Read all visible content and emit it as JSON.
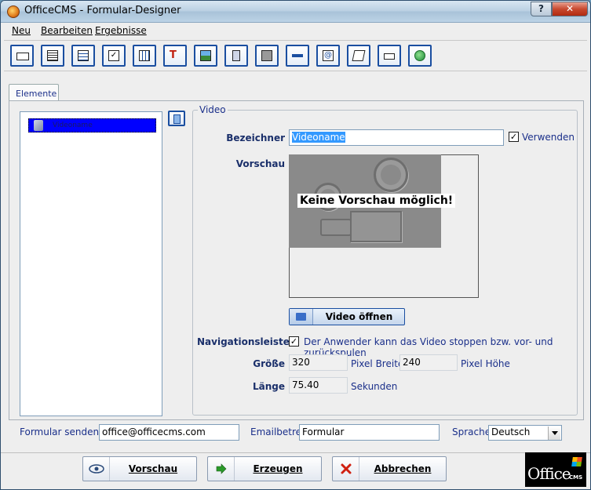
{
  "window": {
    "title": "OfficeCMS - Formular-Designer",
    "help_label": "?",
    "close_label": "✕"
  },
  "menu": {
    "items": [
      {
        "label": "Neu"
      },
      {
        "label": "Bearbeiten"
      },
      {
        "label": "Ergebnisse"
      }
    ]
  },
  "toolbar": {
    "buttons": [
      "textfield-icon",
      "textarea-icon",
      "list-icon",
      "checkbox-icon",
      "table-icon",
      "text-format-icon",
      "image-icon",
      "file-icon",
      "frame-icon",
      "separator-icon",
      "email-icon",
      "form-icon",
      "box-icon",
      "globe-icon"
    ]
  },
  "tabs": {
    "elements_label": "Elemente"
  },
  "element_list": {
    "selected_item": "Videoname"
  },
  "video_group": {
    "title": "Video",
    "bezeichner_label": "Bezeichner",
    "bezeichner_value": "Videoname",
    "verwenden_label": "Verwenden",
    "verwenden_checked": true,
    "vorschau_label": "Vorschau",
    "preview_message": "Keine Vorschau möglich!",
    "open_button_label": "Video öffnen",
    "navigationsleiste_label": "Navigationsleiste",
    "navigationsleiste_checked": true,
    "navigationsleiste_text": "Der Anwender kann das Video stoppen bzw. vor- und zurückspulen",
    "groesse_label": "Größe",
    "width_value": "320",
    "width_unit": "Pixel Breite",
    "height_value": "240",
    "height_unit": "Pixel Höhe",
    "laenge_label": "Länge",
    "laenge_value": "75.40",
    "laenge_unit": "Sekunden"
  },
  "form_settings": {
    "send_label": "Formular senden an",
    "send_value": "office@officecms.com",
    "subject_label": "Emailbetreff",
    "subject_value": "Formular",
    "language_label": "Sprache",
    "language_value": "Deutsch"
  },
  "actions": {
    "preview_label": "Vorschau",
    "generate_label": "Erzeugen",
    "cancel_label": "Abbrechen"
  },
  "logo": {
    "word": "Office",
    "sub": "CMS"
  },
  "colors": {
    "accent_blue": "#1a4ea0",
    "label_blue": "#1a2f6a",
    "selection_blue": "#0000ff"
  }
}
